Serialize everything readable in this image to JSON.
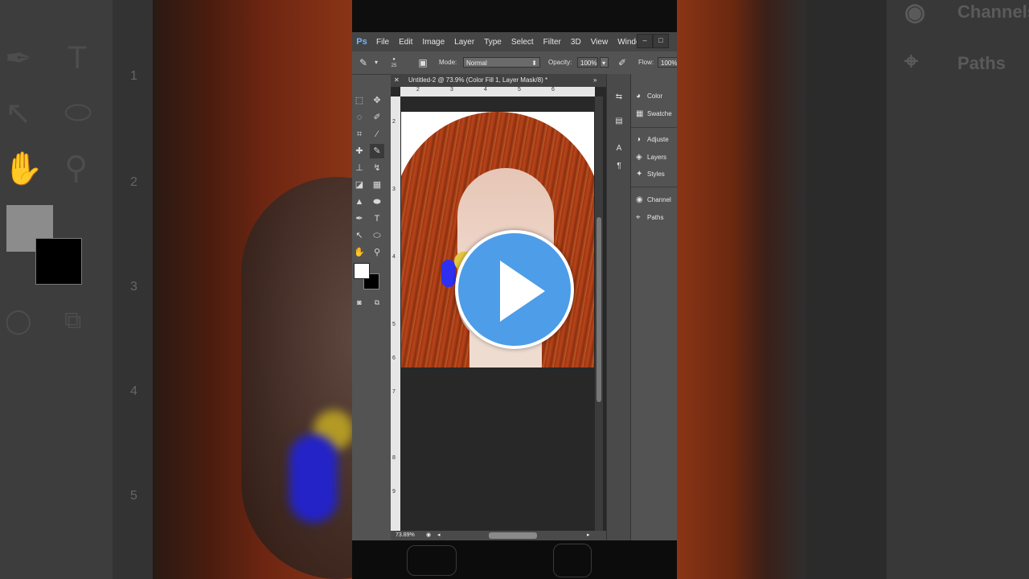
{
  "background": {
    "left_panel": "blurred-photoshop-left",
    "right_panel": {
      "channels_label": "Channels",
      "paths_label": "Paths"
    },
    "ruler_numbers": [
      "1",
      "2",
      "3",
      "4",
      "5"
    ]
  },
  "menubar": {
    "logo": "Ps",
    "items": [
      "File",
      "Edit",
      "Image",
      "Layer",
      "Type",
      "Select",
      "Filter",
      "3D",
      "View",
      "Windo"
    ]
  },
  "options_bar": {
    "brush_size": "25",
    "mode_label": "Mode:",
    "mode_value": "Normal",
    "opacity_label": "Opacity:",
    "opacity_value": "100%",
    "flow_label": "Flow:",
    "flow_value": "100%"
  },
  "document": {
    "tab_title": "Untitled-2 @ 73.9% (Color Fill 1, Layer Mask/8) *",
    "h_ruler": [
      "2",
      "3",
      "4",
      "5",
      "6"
    ],
    "v_ruler": [
      "2",
      "3",
      "4",
      "5",
      "6",
      "7",
      "8",
      "9"
    ],
    "zoom": "73.89%"
  },
  "panels": {
    "items": [
      "Color",
      "Swatche",
      "Adjuste",
      "Layers",
      "Styles",
      "Channel",
      "Paths"
    ]
  },
  "colors": {
    "accent_play": "#4d9de8",
    "foreground": "#ffffff",
    "background_color": "#000000",
    "paint_blue": "#2d30f0",
    "paint_yellow": "#e5c640"
  },
  "overlay": {
    "play_icon": "play-icon"
  }
}
